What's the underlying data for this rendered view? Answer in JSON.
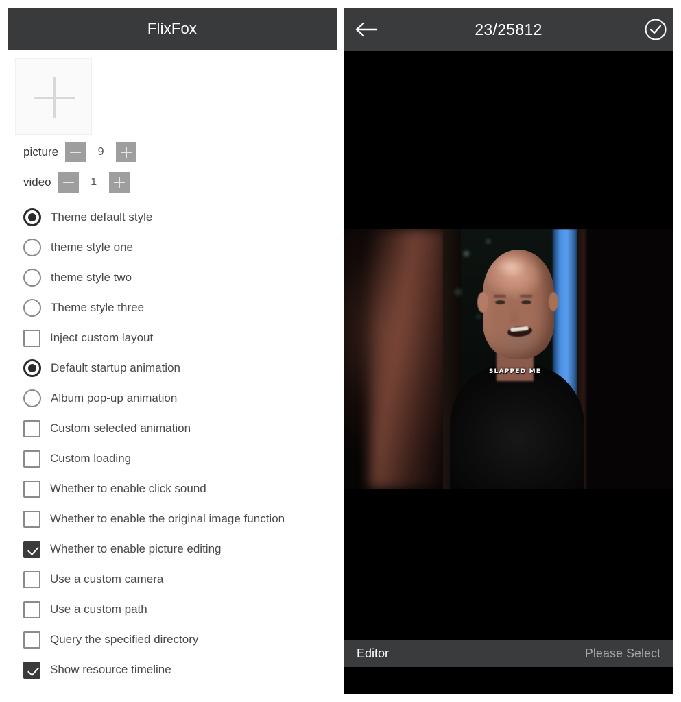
{
  "left": {
    "app_title": "FlixFox",
    "add_tile": {
      "icon": "plus-icon"
    },
    "steppers": [
      {
        "label": "picture",
        "value": "9",
        "minus_icon": "minus-icon",
        "plus_icon": "plus-icon"
      },
      {
        "label": "video",
        "value": "1",
        "minus_icon": "minus-icon",
        "plus_icon": "plus-icon"
      }
    ],
    "options": [
      {
        "type": "radio",
        "label": "Theme default style",
        "checked": true
      },
      {
        "type": "radio",
        "label": "theme style one",
        "checked": false
      },
      {
        "type": "radio",
        "label": "theme style two",
        "checked": false
      },
      {
        "type": "radio",
        "label": "Theme style three",
        "checked": false
      },
      {
        "type": "checkbox",
        "label": "Inject custom layout",
        "checked": false
      },
      {
        "type": "radio",
        "label": "Default startup animation",
        "checked": true
      },
      {
        "type": "radio",
        "label": "Album pop-up animation",
        "checked": false
      },
      {
        "type": "checkbox",
        "label": "Custom selected animation",
        "checked": false
      },
      {
        "type": "checkbox",
        "label": "Custom loading",
        "checked": false
      },
      {
        "type": "checkbox",
        "label": "Whether to enable click sound",
        "checked": false
      },
      {
        "type": "checkbox",
        "label": "Whether to enable the original image function",
        "checked": false
      },
      {
        "type": "checkbox",
        "label": "Whether to enable picture editing",
        "checked": true
      },
      {
        "type": "checkbox",
        "label": "Use a custom camera",
        "checked": false
      },
      {
        "type": "checkbox",
        "label": "Use a custom path",
        "checked": false
      },
      {
        "type": "checkbox",
        "label": "Query the specified directory",
        "checked": false
      },
      {
        "type": "checkbox",
        "label": "Show resource timeline",
        "checked": true
      }
    ]
  },
  "right": {
    "back_icon": "back-arrow-icon",
    "counter": "23/25812",
    "confirm_icon": "check-circle-icon",
    "preview": {
      "subtitle": "SLAPPED ME"
    },
    "bottom": {
      "editor_label": "Editor",
      "select_label": "Please Select"
    }
  },
  "colors": {
    "appbar": "#3a3b3d",
    "stage": "#000000",
    "control_gray": "#9e9e9e",
    "checked": "#3b3b3b"
  }
}
